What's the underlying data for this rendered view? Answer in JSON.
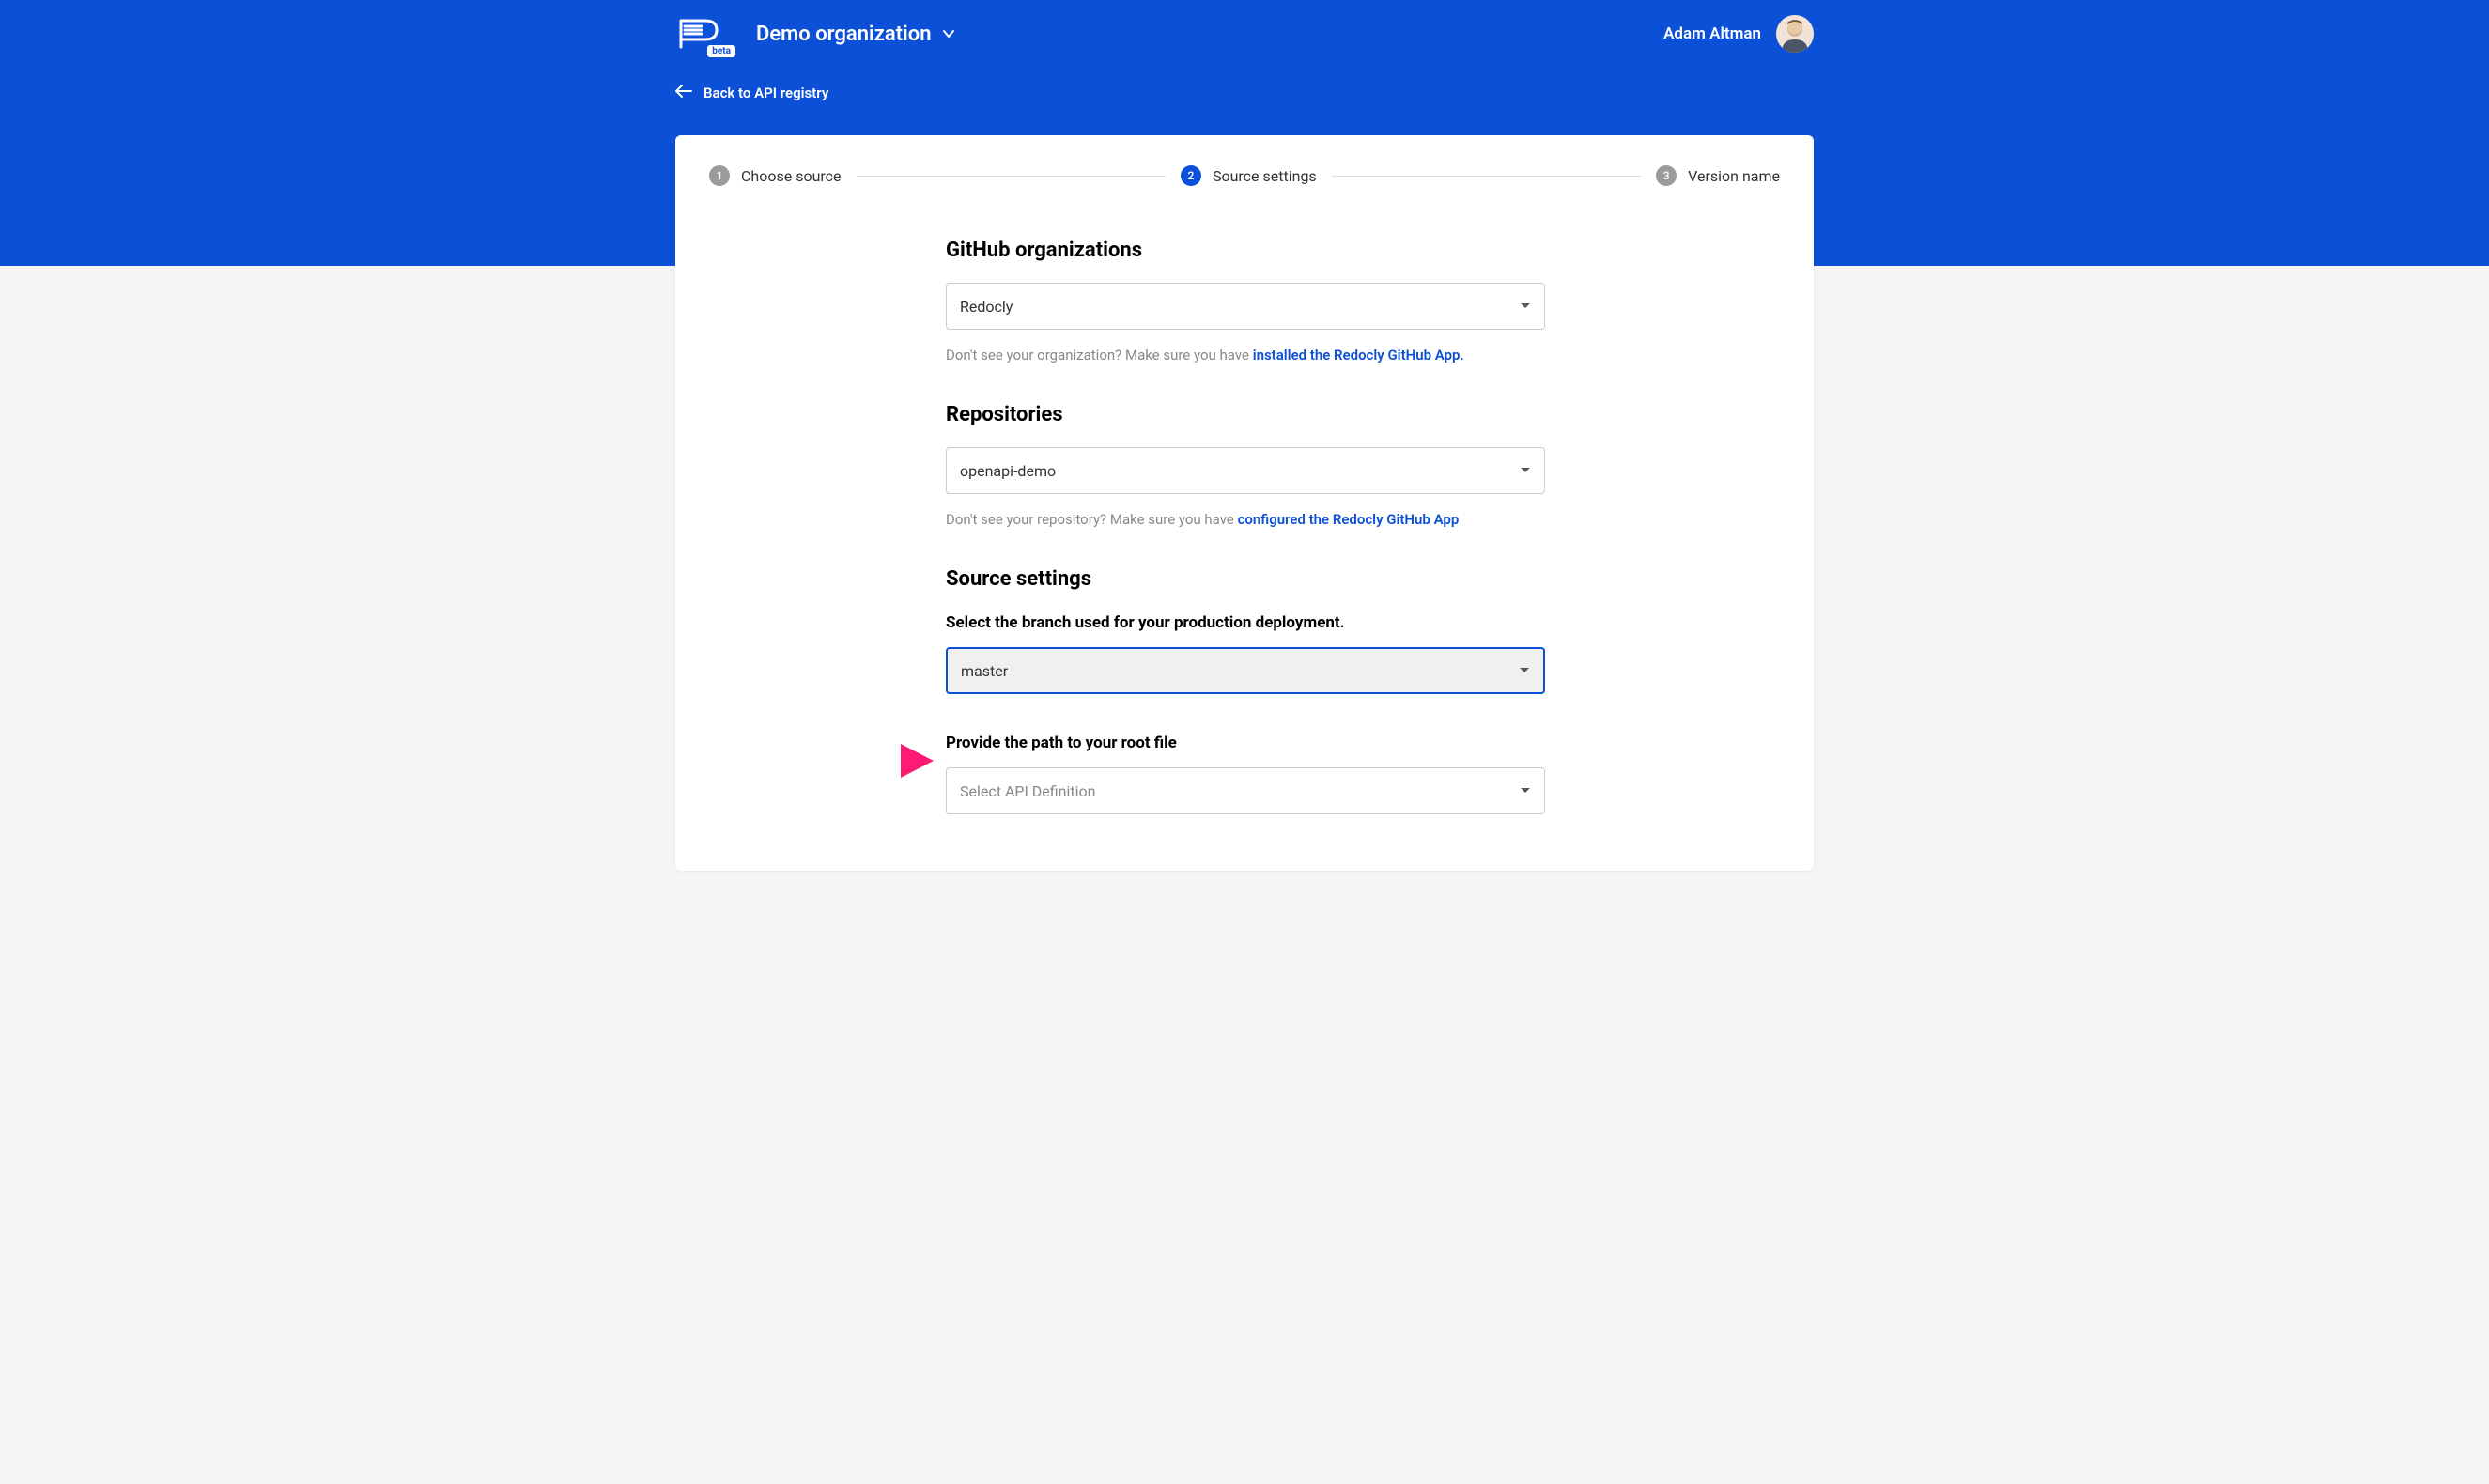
{
  "header": {
    "logo_badge": "beta",
    "org_name": "Demo organization",
    "user_name": "Adam Altman"
  },
  "nav": {
    "back_label": "Back to API registry"
  },
  "stepper": {
    "steps": [
      {
        "num": "1",
        "label": "Choose source"
      },
      {
        "num": "2",
        "label": "Source settings"
      },
      {
        "num": "3",
        "label": "Version name"
      }
    ]
  },
  "form": {
    "github_orgs": {
      "heading": "GitHub organizations",
      "selected": "Redocly",
      "helper_prefix": "Don't see your organization? Make sure you have ",
      "helper_link": "installed the Redocly GitHub App."
    },
    "repositories": {
      "heading": "Repositories",
      "selected": "openapi-demo",
      "helper_prefix": "Don't see your repository? Make sure you have ",
      "helper_link": "configured the Redocly GitHub App"
    },
    "source_settings": {
      "heading": "Source settings",
      "branch_label": "Select the branch used for your production deployment.",
      "branch_selected": "master",
      "root_label": "Provide the path to your root file",
      "root_placeholder": "Select API Definition"
    }
  }
}
